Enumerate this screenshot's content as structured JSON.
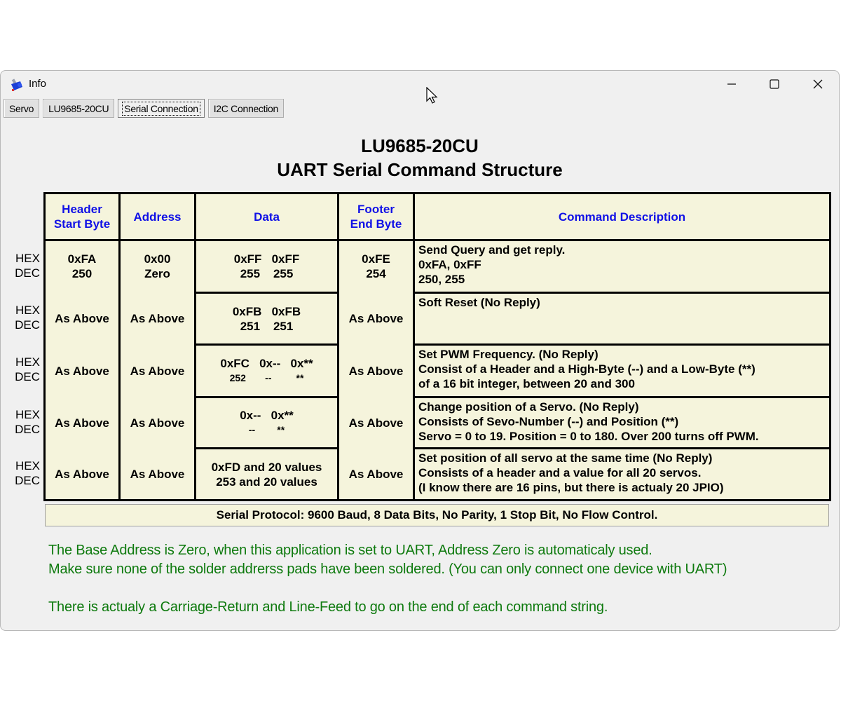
{
  "window": {
    "title": "Info",
    "icon": "servo-app-icon",
    "controls": {
      "minimize": "minimize-icon",
      "maximize": "maximize-icon",
      "close": "close-icon"
    }
  },
  "tabs": [
    {
      "label": "Servo",
      "active": false
    },
    {
      "label": "LU9685-20CU",
      "active": false
    },
    {
      "label": "Serial Connection",
      "active": true
    },
    {
      "label": "I2C Connection",
      "active": false
    }
  ],
  "heading": {
    "line1": "LU9685-20CU",
    "line2": "UART Serial Command Structure"
  },
  "table": {
    "headers": {
      "header": "Header\nStart Byte",
      "address": "Address",
      "data": "Data",
      "footer": "Footer\nEnd Byte",
      "description": "Command Description"
    },
    "row_side_label": {
      "hex": "HEX",
      "dec": "DEC"
    },
    "header_value": {
      "hex": "0xFA",
      "dec": "250"
    },
    "address_value": {
      "hex": "0x00",
      "dec": "Zero"
    },
    "footer_value": {
      "hex": "0xFE",
      "dec": "254"
    },
    "as_above": "As Above",
    "rows": [
      {
        "data_hex": "0xFF   0xFF",
        "data_dec": "255    255",
        "description": "Send Query and get reply.\n0xFA, 0xFF\n 250,   255"
      },
      {
        "data_hex": "0xFB   0xFB",
        "data_dec": "251    251",
        "description": "Soft Reset (No Reply)"
      },
      {
        "data_hex": "0xFC   0x--   0x**",
        "data_dec": "252       --         **",
        "description": "Set PWM Frequency. (No Reply)\nConsist of a Header and a High-Byte (--) and a Low-Byte (**)\nof a 16 bit integer, between 20 and 300"
      },
      {
        "data_hex": "0x--   0x**",
        "data_dec": "--        **",
        "description": "Change position of a Servo. (No Reply)\nConsists of Sevo-Number (--) and Position (**)\nServo = 0 to 19. Position = 0 to 180. Over 200 turns off PWM."
      },
      {
        "data_hex": "0xFD and 20 values",
        "data_dec": "253 and 20 values",
        "description": "Set position of all servo at the same time (No Reply)\nConsists of a header and a value for all 20 servos.\n(I know there are 16 pins, but there is actualy 20 JPIO)"
      }
    ]
  },
  "protocol": "Serial Protocol: 9600 Baud, 8 Data Bits, No Parity, 1 Stop Bit, No Flow Control.",
  "notes": [
    "The Base Address is Zero, when this application is set to UART, Address Zero is automaticaly used.",
    "Make sure none of the solder addrerss pads have been soldered. (You can only connect one device with UART)",
    "There is actualy a Carriage-Return and Line-Feed to go on the end of each command string."
  ],
  "colors": {
    "header_text": "#1010e6",
    "table_bg": "#f5f4dc",
    "note_text": "#0e7a0e",
    "window_bg": "#f0f0f0"
  }
}
